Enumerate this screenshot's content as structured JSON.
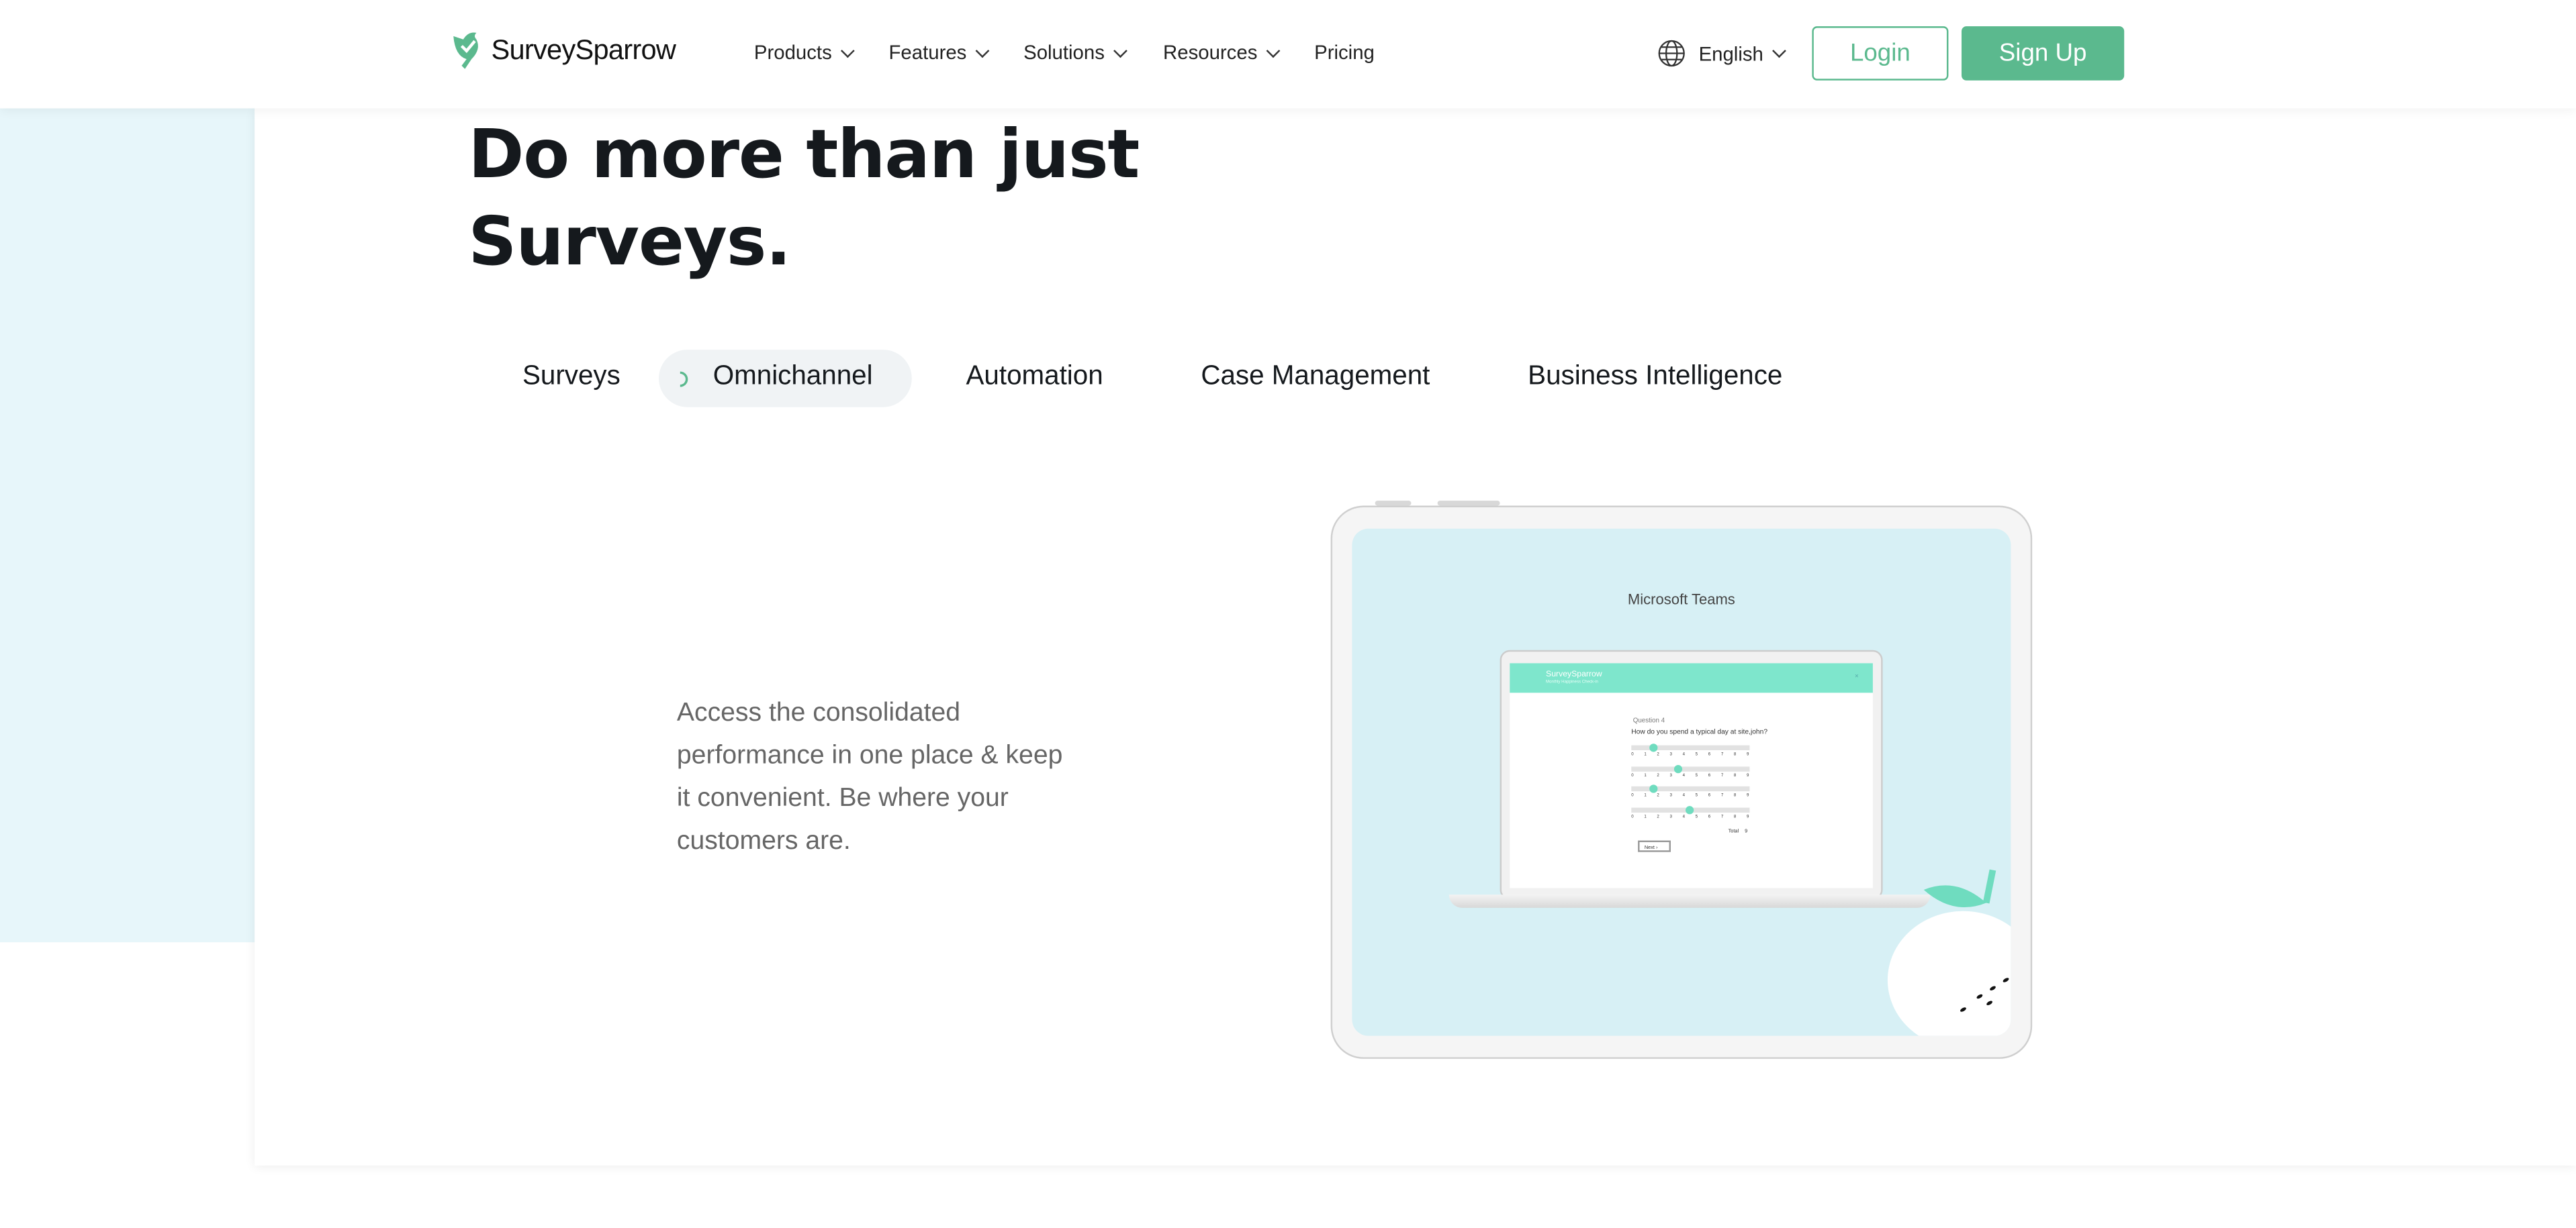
{
  "header": {
    "brand": "SurveySparrow",
    "nav": [
      {
        "label": "Products",
        "dropdown": true
      },
      {
        "label": "Features",
        "dropdown": true
      },
      {
        "label": "Solutions",
        "dropdown": true
      },
      {
        "label": "Resources",
        "dropdown": true
      },
      {
        "label": "Pricing",
        "dropdown": false
      }
    ],
    "language": "English",
    "login": "Login",
    "signup": "Sign Up"
  },
  "hero": {
    "title_line1": "Do more than just",
    "title_line2": "Surveys."
  },
  "tabs": [
    {
      "label": "Surveys",
      "active": false
    },
    {
      "label": "Omnichannel",
      "active": true
    },
    {
      "label": "Automation",
      "active": false
    },
    {
      "label": "Case Management",
      "active": false
    },
    {
      "label": "Business Intelligence",
      "active": false
    }
  ],
  "panel": {
    "description": "Access the consolidated performance in one place & keep it convenient. Be where your customers are.",
    "device_title": "Microsoft Teams",
    "survey": {
      "brand": "SurveySparrow",
      "subtitle": "Monthly Happiness Check-in",
      "question_number": "Question 4",
      "question": "How do you spend a typical day at site,john?",
      "sliders": [
        1,
        3,
        1,
        4
      ],
      "scale": [
        "0",
        "1",
        "2",
        "3",
        "4",
        "5",
        "6",
        "7",
        "8",
        "9"
      ],
      "total_label": "Total",
      "total": "9",
      "next": "Next"
    }
  },
  "colors": {
    "brand_green": "#5bb98e",
    "left_panel": "#e7f6fa",
    "device_screen": "#d7f0f5",
    "survey_header": "#7ee6cc"
  }
}
